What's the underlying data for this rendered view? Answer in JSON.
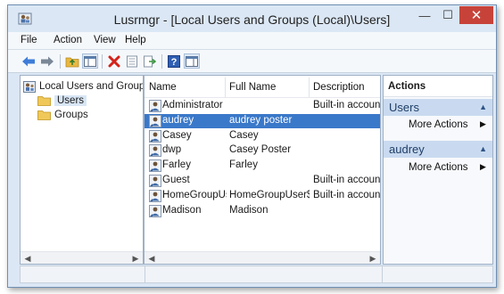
{
  "window": {
    "title": "Lusrmgr - [Local Users and Groups (Local)\\Users]",
    "minimize": "—",
    "maximize": "☐",
    "close": "✕"
  },
  "menu": [
    "File",
    "Action",
    "View",
    "Help"
  ],
  "toolbar": {
    "icons": [
      "back-arrow-icon",
      "forward-arrow-icon",
      "up-folder-icon",
      "show-hide-tree-icon",
      "delete-icon",
      "properties-icon",
      "export-list-icon",
      "help-icon",
      "show-hide-action-pane-icon"
    ]
  },
  "tree": {
    "root": "Local Users and Groups",
    "children": [
      {
        "label": "Users",
        "selected": true
      },
      {
        "label": "Groups",
        "selected": false
      }
    ]
  },
  "list": {
    "columns": [
      "Name",
      "Full Name",
      "Description"
    ],
    "rows": [
      {
        "name": "Administrator",
        "full": "",
        "desc": "Built-in account",
        "selected": false
      },
      {
        "name": "audrey",
        "full": "audrey poster",
        "desc": "",
        "selected": true
      },
      {
        "name": "Casey",
        "full": "Casey",
        "desc": "",
        "selected": false
      },
      {
        "name": "dwp",
        "full": "Casey Poster",
        "desc": "",
        "selected": false
      },
      {
        "name": "Farley",
        "full": "Farley",
        "desc": "",
        "selected": false
      },
      {
        "name": "Guest",
        "full": "",
        "desc": "Built-in account",
        "selected": false
      },
      {
        "name": "HomeGroupUser$",
        "full": "HomeGroupUser$",
        "desc": "Built-in account",
        "selected": false
      },
      {
        "name": "Madison",
        "full": "Madison",
        "desc": "",
        "selected": false
      }
    ]
  },
  "actions": {
    "title": "Actions",
    "sections": [
      {
        "header": "Users",
        "item": "More Actions"
      },
      {
        "header": "audrey",
        "item": "More Actions"
      }
    ]
  },
  "colors": {
    "selection": "#3a78c9",
    "action_header": "#c9daf0",
    "close_button": "#c7433a"
  }
}
